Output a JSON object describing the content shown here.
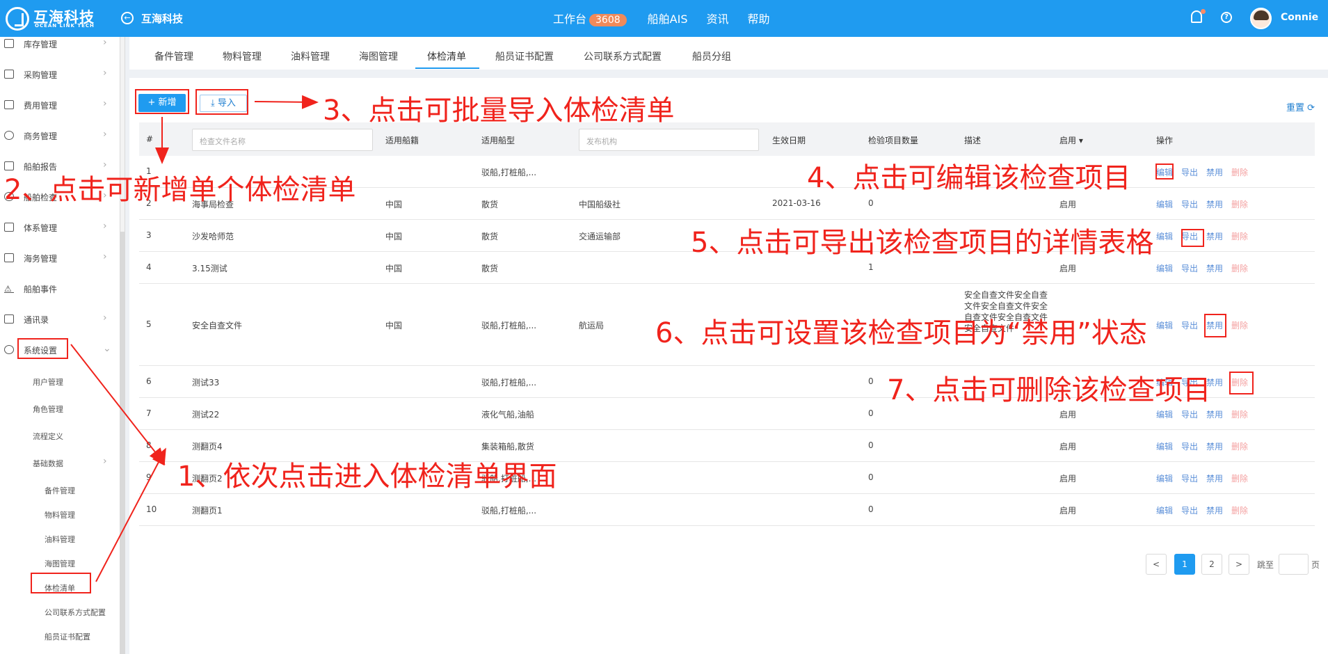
{
  "header": {
    "brand_name": "互海科技",
    "brand_sub": "OCEAN LINK TECH",
    "company": "互海科技",
    "nav": [
      {
        "label": "工作台",
        "badge": "3608"
      },
      {
        "label": "船舶AIS"
      },
      {
        "label": "资讯"
      },
      {
        "label": "帮助"
      }
    ],
    "username": "Connie"
  },
  "sidebar": {
    "items": [
      {
        "label": "库存管理"
      },
      {
        "label": "采购管理"
      },
      {
        "label": "费用管理"
      },
      {
        "label": "商务管理"
      },
      {
        "label": "船舶报告"
      },
      {
        "label": "船舶检查"
      },
      {
        "label": "体系管理"
      },
      {
        "label": "海务管理"
      },
      {
        "label": "船舶事件"
      },
      {
        "label": "通讯录"
      },
      {
        "label": "系统设置"
      }
    ],
    "sub_items": [
      "用户管理",
      "角色管理",
      "流程定义",
      "基础数据"
    ],
    "sub_sub_items": [
      "备件管理",
      "物料管理",
      "油料管理",
      "海图管理",
      "体检清单",
      "公司联系方式配置",
      "船员证书配置"
    ]
  },
  "tabs": [
    "备件管理",
    "物料管理",
    "油料管理",
    "海图管理",
    "体检清单",
    "船员证书配置",
    "公司联系方式配置",
    "船员分组"
  ],
  "toolbar": {
    "add_label": "+ 新增",
    "import_label": "⤓ 导入",
    "reset_label": "重置"
  },
  "table": {
    "headers": {
      "index": "#",
      "name_placeholder": "检查文件名称",
      "nationality": "适用船籍",
      "ship_type": "适用船型",
      "publisher_placeholder": "发布机构",
      "effective_date": "生效日期",
      "item_count": "检验项目数量",
      "description": "描述",
      "status": "启用 ▾",
      "actions": "操作"
    },
    "actions": {
      "edit": "编辑",
      "export": "导出",
      "disable": "禁用",
      "delete": "删除"
    },
    "rows": [
      {
        "index": "1",
        "name": "",
        "nationality": "",
        "ship_type": "驳船,打桩船,...",
        "publisher": "",
        "date": "",
        "count": "1",
        "desc": "",
        "status": ""
      },
      {
        "index": "2",
        "name": "海事局检查",
        "nationality": "中国",
        "ship_type": "散货",
        "publisher": "中国船级社",
        "date": "2021-03-16",
        "count": "0",
        "desc": "",
        "status": "启用"
      },
      {
        "index": "3",
        "name": "沙发哈师范",
        "nationality": "中国",
        "ship_type": "散货",
        "publisher": "交通运输部",
        "date": "",
        "count": "",
        "desc": "",
        "status": ""
      },
      {
        "index": "4",
        "name": "3.15测试",
        "nationality": "中国",
        "ship_type": "散货",
        "publisher": "",
        "date": "",
        "count": "1",
        "desc": "",
        "status": "启用"
      },
      {
        "index": "5",
        "name": "安全自查文件",
        "nationality": "中国",
        "ship_type": "驳船,打桩船,...",
        "publisher": "航运局",
        "date": "",
        "count": "",
        "desc": "安全自查文件安全自查文件安全自查文件安全自查文件安全自查文件安全自查文件",
        "status": ""
      },
      {
        "index": "6",
        "name": "测试33",
        "nationality": "",
        "ship_type": "驳船,打桩船,...",
        "publisher": "",
        "date": "",
        "count": "0",
        "desc": "",
        "status": ""
      },
      {
        "index": "7",
        "name": "测试22",
        "nationality": "",
        "ship_type": "液化气船,油船",
        "publisher": "",
        "date": "",
        "count": "0",
        "desc": "",
        "status": "启用"
      },
      {
        "index": "8",
        "name": "测翻页4",
        "nationality": "",
        "ship_type": "集装箱船,散货",
        "publisher": "",
        "date": "",
        "count": "0",
        "desc": "",
        "status": "启用"
      },
      {
        "index": "9",
        "name": "测翻页2",
        "nationality": "",
        "ship_type": "驳船,打桩船,...",
        "publisher": "",
        "date": "",
        "count": "0",
        "desc": "",
        "status": "启用"
      },
      {
        "index": "10",
        "name": "测翻页1",
        "nationality": "",
        "ship_type": "驳船,打桩船,...",
        "publisher": "",
        "date": "",
        "count": "0",
        "desc": "",
        "status": "启用"
      }
    ]
  },
  "pagination": {
    "prev": "<",
    "pages": [
      "1",
      "2"
    ],
    "next": ">",
    "goto_label": "跳至",
    "goto_suffix": "页"
  },
  "annotations": {
    "a1": "1、依次点击进入体检清单界面",
    "a2": "2、点击可新增单个体检清单",
    "a3": "3、点击可批量导入体检清单",
    "a4": "4、点击可编辑该检查项目",
    "a5": "5、点击可导出该检查项目的详情表格",
    "a6": "6、点击可设置该检查项目为“禁用”状态",
    "a7": "7、点击可删除该检查项目"
  }
}
